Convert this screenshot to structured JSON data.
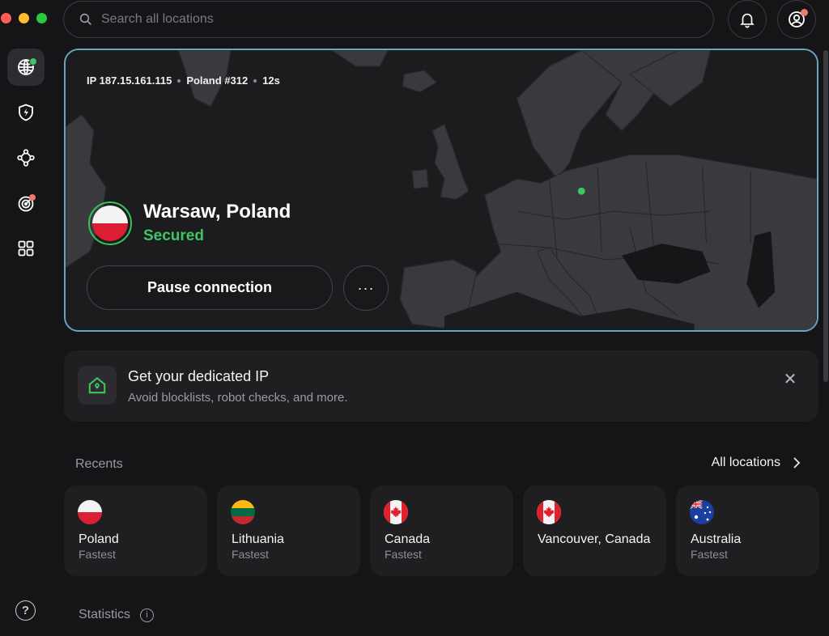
{
  "window": {
    "traffic_lights": {
      "close": "#ff5f57",
      "minimize": "#febc2e",
      "zoom": "#28c840"
    }
  },
  "search": {
    "placeholder": "Search all locations",
    "value": ""
  },
  "sidebar": {
    "items": [
      {
        "icon": "globe-icon",
        "active": true
      },
      {
        "icon": "shield-bolt-icon",
        "active": false
      },
      {
        "icon": "meshnet-icon",
        "active": false
      },
      {
        "icon": "target-icon",
        "active": false
      },
      {
        "icon": "apps-grid-icon",
        "active": false
      }
    ],
    "help_label": "?"
  },
  "header": {
    "bell_icon": "bell-icon",
    "account_icon": "account-icon"
  },
  "connection": {
    "ip": "IP 187.15.161.115",
    "server": "Poland #312",
    "duration": "12s",
    "city": "Warsaw, Poland",
    "status": "Secured",
    "pause_label": "Pause connection",
    "more_label": "···"
  },
  "banner": {
    "title": "Get your dedicated IP",
    "subtitle": "Avoid blocklists, robot checks, and more.",
    "close_label": "✕"
  },
  "recents": {
    "label": "Recents",
    "all_locations": "All locations",
    "items": [
      {
        "name": "Poland",
        "sub": "Fastest",
        "flag": "poland"
      },
      {
        "name": "Lithuania",
        "sub": "Fastest",
        "flag": "lithuania"
      },
      {
        "name": "Canada",
        "sub": "Fastest",
        "flag": "canada"
      },
      {
        "name": "Vancouver, Canada",
        "sub": "",
        "flag": "canada"
      },
      {
        "name": "Australia",
        "sub": "Fastest",
        "flag": "australia"
      }
    ]
  },
  "statistics": {
    "label": "Statistics",
    "info": "i"
  },
  "colors": {
    "accent_green": "#3ec463",
    "card_border": "#6aa5bd",
    "notification_dot": "#f07a6a"
  }
}
